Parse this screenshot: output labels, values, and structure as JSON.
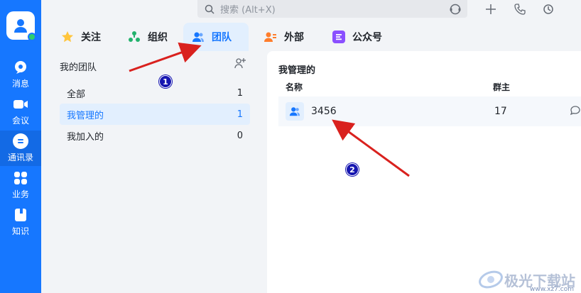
{
  "search": {
    "placeholder": "搜索 (Alt+X)"
  },
  "rail": {
    "items": [
      {
        "label": "消息",
        "icon": "chat-icon"
      },
      {
        "label": "会议",
        "icon": "video-icon"
      },
      {
        "label": "通讯录",
        "icon": "contacts-icon",
        "active": true
      },
      {
        "label": "业务",
        "icon": "apps-icon"
      },
      {
        "label": "知识",
        "icon": "book-icon"
      }
    ]
  },
  "tabs": [
    {
      "label": "关注",
      "icon": "star-icon"
    },
    {
      "label": "组织",
      "icon": "org-icon"
    },
    {
      "label": "团队",
      "icon": "team-icon",
      "active": true
    },
    {
      "label": "外部",
      "icon": "external-contact-icon"
    },
    {
      "label": "公众号",
      "icon": "official-account-icon"
    }
  ],
  "left_panel": {
    "title": "我的团队",
    "rows": [
      {
        "label": "全部",
        "count": "1"
      },
      {
        "label": "我管理的",
        "count": "1",
        "active": true
      },
      {
        "label": "我加入的",
        "count": "0"
      }
    ]
  },
  "right_panel": {
    "title": "我管理的",
    "col_name": "名称",
    "col_owner": "群主",
    "rows": [
      {
        "name": "3456",
        "owner": "17"
      }
    ]
  },
  "annotations": {
    "badge1": "1",
    "badge2": "2"
  },
  "watermark": {
    "text": "极光下载站",
    "url": "www.xz7.com"
  },
  "colors": {
    "accent": "#1677ff",
    "rail_bg": "#1677ff",
    "annotation_arrow": "#d9211e",
    "badge": "#1616b0"
  }
}
